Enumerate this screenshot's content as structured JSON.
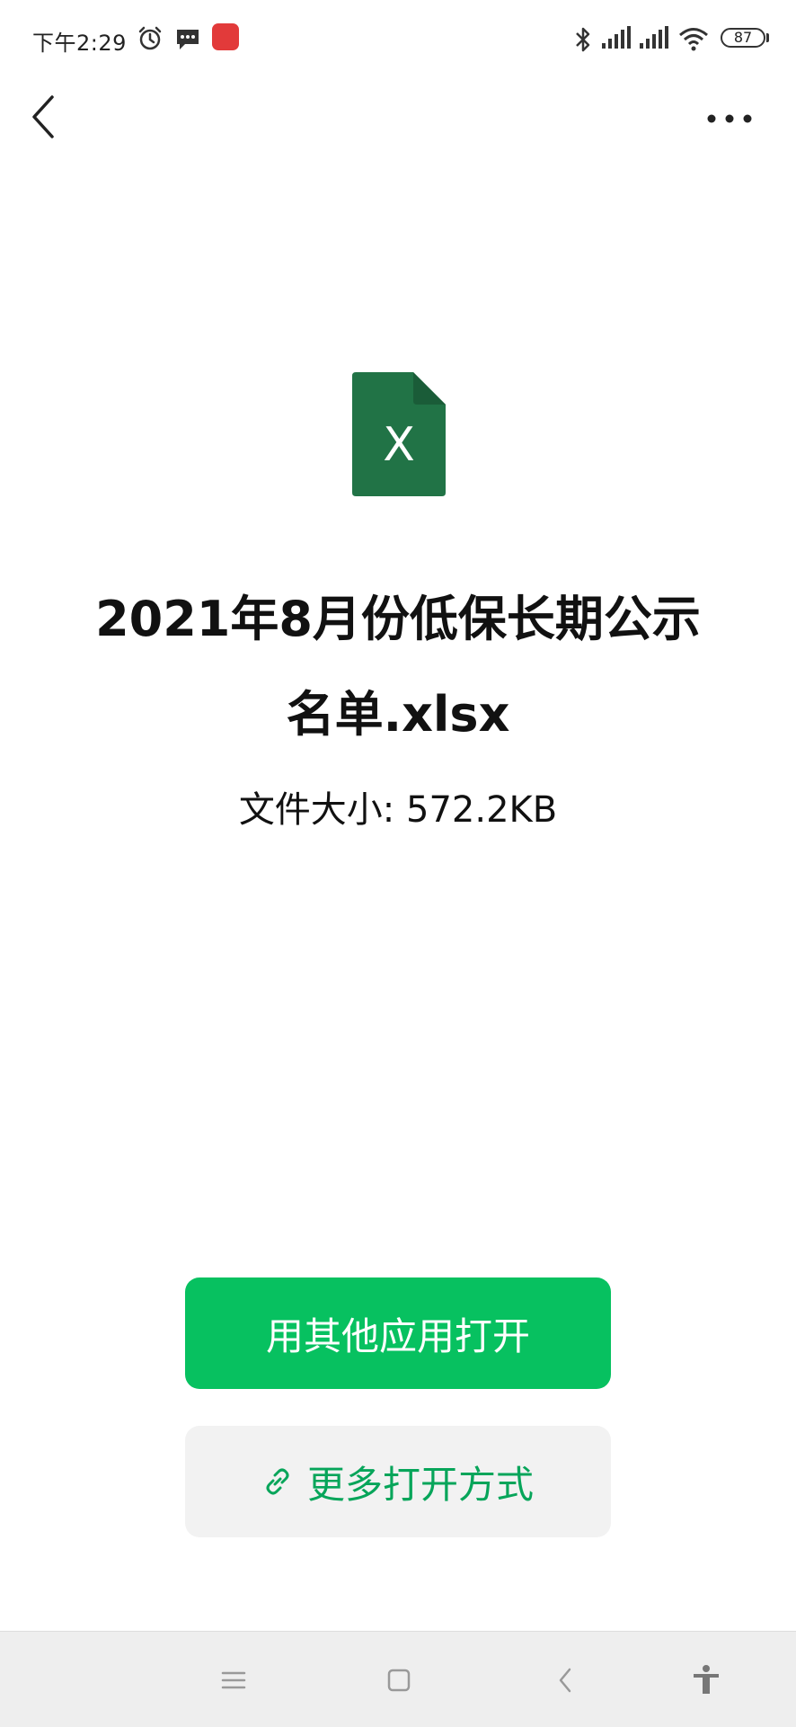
{
  "status_bar": {
    "time": "下午2:29",
    "battery": "87",
    "icons": [
      "alarm-icon",
      "message-icon",
      "app-badge-icon",
      "bluetooth-icon",
      "signal-icon",
      "signal-icon",
      "wifi-icon",
      "battery-icon"
    ]
  },
  "nav": {
    "back_icon": "chevron-left-icon",
    "more_icon": "more-dots-icon"
  },
  "file": {
    "icon": "excel-file-icon",
    "icon_letter": "X",
    "name": "2021年8月份低保长期公示名单.xlsx",
    "size_text": "文件大小: 572.2KB"
  },
  "actions": {
    "open_other_app": "用其他应用打开",
    "more_open_ways": "更多打开方式"
  },
  "colors": {
    "accent_green": "#07c160",
    "excel_green": "#217346",
    "secondary_text_green": "#07a55a"
  },
  "system_nav": {
    "icons": [
      "menu-icon",
      "home-square-icon",
      "back-icon",
      "accessibility-icon"
    ]
  }
}
